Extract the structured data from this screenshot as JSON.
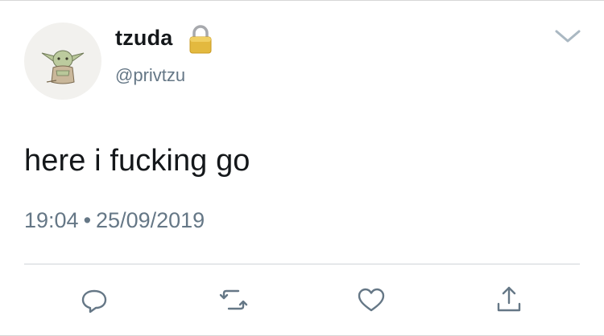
{
  "user": {
    "display_name": "tzuda",
    "handle": "@privtzu",
    "locked_icon": "lock-icon",
    "avatar_icon": "yoda-avatar"
  },
  "tweet": {
    "text": "here i fucking go",
    "time": "19:04",
    "separator": "•",
    "date": "25/09/2019"
  },
  "menu": {
    "icon": "chevron-down-icon"
  },
  "actions": [
    {
      "icon": "reply-icon"
    },
    {
      "icon": "retweet-icon"
    },
    {
      "icon": "like-icon"
    },
    {
      "icon": "share-icon"
    }
  ],
  "colors": {
    "text": "#14171a",
    "secondary": "#657786",
    "divider": "#cfd4d8",
    "action_icon": "#657786"
  }
}
